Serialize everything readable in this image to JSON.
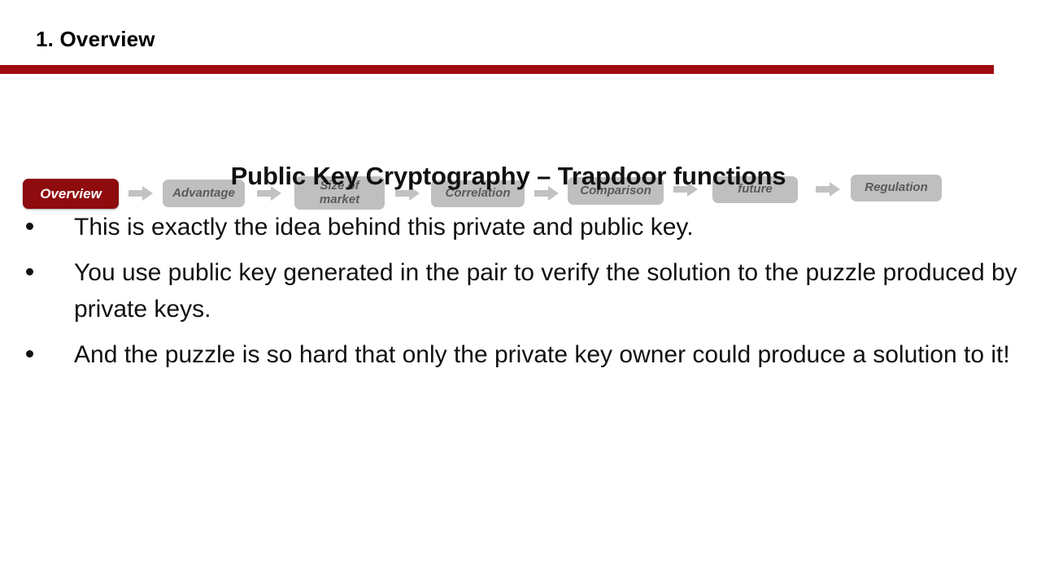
{
  "header": {
    "section_title": "1. Overview",
    "rule_color": "#9E0C10"
  },
  "breadcrumb": {
    "active_color": "#8E0B0E",
    "inactive_color": "#BFBFBF",
    "inactive_text_color": "#5A5A5A",
    "arrow_icon": "right-arrow-icon",
    "steps": [
      {
        "label": "Overview",
        "active": true
      },
      {
        "label": "Advantage",
        "active": false
      },
      {
        "label": "Size of\nmarket",
        "active": false
      },
      {
        "label": "Correlation",
        "active": false
      },
      {
        "label": "Comparison",
        "active": false
      },
      {
        "label": "future",
        "active": false
      },
      {
        "label": "Regulation",
        "active": false
      }
    ]
  },
  "content": {
    "title": "Public Key Cryptography – Trapdoor functions",
    "bullets": [
      "This is exactly the idea behind this private and public key.",
      "You use public key generated in the pair to verify the solution to the puzzle produced by private keys.",
      "And the puzzle is so hard that only the private key owner could produce a solution to it!"
    ]
  }
}
